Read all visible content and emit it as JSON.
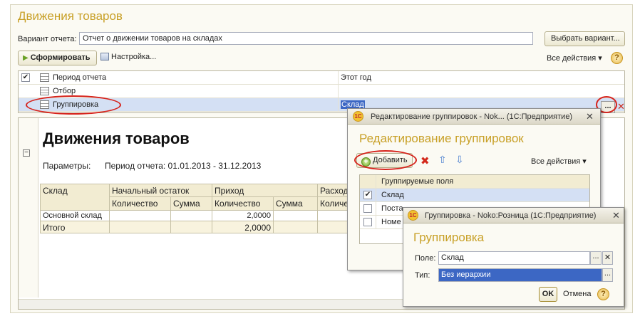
{
  "window": {
    "title": "Движения товаров",
    "variant_label": "Вариант отчета:",
    "variant_value": "Отчет о движении товаров на складах",
    "select_variant_label": "Выбрать вариант...",
    "generate_label": "Сформировать",
    "settings_label": "Настройка...",
    "all_actions_label": "Все действия ▾",
    "help_label": "?"
  },
  "settings_table": {
    "rows": [
      {
        "label": "Период отчета",
        "value": "Этот год",
        "checked": true
      },
      {
        "label": "Отбор",
        "value": "",
        "checked": false
      },
      {
        "label": "Группировка",
        "value": "Склад",
        "checked": false
      }
    ],
    "ellipsis_label": "...",
    "clear_label": "✕"
  },
  "report": {
    "title": "Движения товаров",
    "params_label": "Параметры:",
    "params_value": "Период отчета: 01.01.2013 - 31.12.2013",
    "columns": {
      "warehouse": "Склад",
      "opening": "Начальный остаток",
      "income": "Приход",
      "expense": "Расход",
      "quantity": "Количество",
      "amount": "Сумма",
      "quantity_cut": "Количе"
    },
    "rows": [
      {
        "warehouse": "Основной склад",
        "income_qty": "2,0000"
      }
    ],
    "total": {
      "label": "Итого",
      "income_qty": "2,0000"
    }
  },
  "dialog_grouping_edit": {
    "title": "Редактирование группировок - Nok...  (1С:Предприятие)",
    "close_label": "✕",
    "heading": "Редактирование группировок",
    "add_label": "Добавить",
    "all_actions_label": "Все действия ▾",
    "table_header": "Группируемые поля",
    "fields": [
      {
        "label": "Склад",
        "checked": true
      },
      {
        "label": "Поста",
        "checked": false
      },
      {
        "label": "Номе",
        "checked": false
      }
    ]
  },
  "dialog_grouping": {
    "title": "Группировка - Noko:Розница  (1С:Предприятие)",
    "close_label": "✕",
    "heading": "Группировка",
    "field_label": "Поле:",
    "field_value": "Склад",
    "type_label": "Тип:",
    "type_value": "Без иерархии",
    "ok_label": "OK",
    "cancel_label": "Отмена",
    "help_label": "?",
    "pick_label": "...",
    "clear_label": "✕"
  },
  "logo_text": "1С"
}
